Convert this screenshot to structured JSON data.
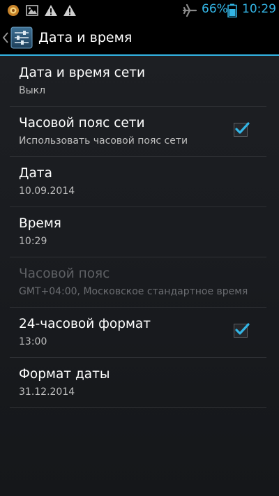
{
  "status_bar": {
    "left_icons": [
      "notification-app-icon",
      "image-icon",
      "warning-icon",
      "warning-icon"
    ],
    "right_icons": [
      "airplane-mode-icon",
      "battery-icon"
    ],
    "battery_percent": "66%",
    "time": "10:29",
    "accent_color": "#33b5e5"
  },
  "action_bar": {
    "title": "Дата и время",
    "back_icon": "chevron-left-icon",
    "app_icon": "settings-sliders-icon"
  },
  "settings": [
    {
      "title": "Дата и время сети",
      "subtitle": "Выкл",
      "checkbox": null,
      "enabled": true
    },
    {
      "title": "Часовой пояс сети",
      "subtitle": "Использовать часовой пояс сети",
      "checkbox": true,
      "enabled": true
    },
    {
      "title": "Дата",
      "subtitle": "10.09.2014",
      "checkbox": null,
      "enabled": true
    },
    {
      "title": "Время",
      "subtitle": "10:29",
      "checkbox": null,
      "enabled": true
    },
    {
      "title": "Часовой пояс",
      "subtitle": "GMT+04:00, Московское стандартное время",
      "checkbox": null,
      "enabled": false
    },
    {
      "title": "24-часовой формат",
      "subtitle": "13:00",
      "checkbox": true,
      "enabled": true
    },
    {
      "title": "Формат даты",
      "subtitle": "31.12.2014",
      "checkbox": null,
      "enabled": true
    }
  ]
}
